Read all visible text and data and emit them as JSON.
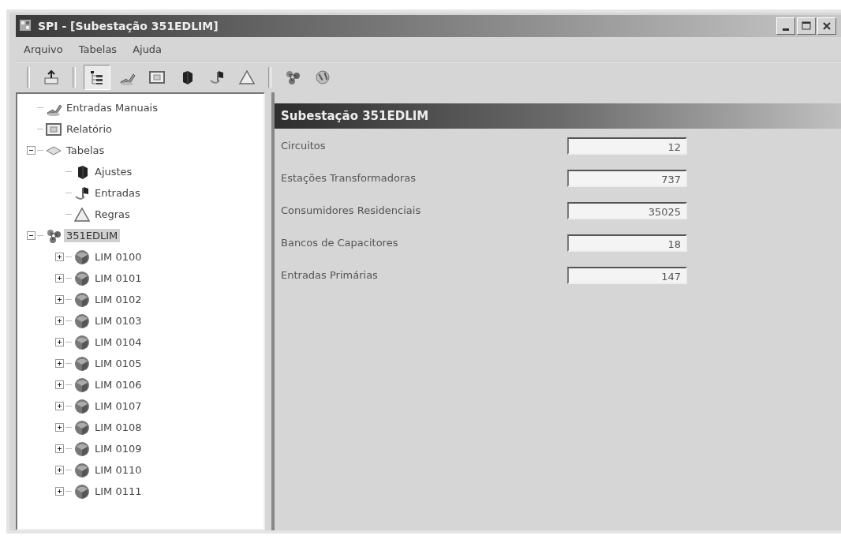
{
  "window": {
    "title": "SPI - [Subestação 351EDLIM]"
  },
  "menu": [
    "Arquivo",
    "Tabelas",
    "Ajuda"
  ],
  "toolbar": [
    {
      "kind": "separator"
    },
    {
      "kind": "upload",
      "selected": false
    },
    {
      "kind": "separator"
    },
    {
      "kind": "tree",
      "selected": true
    },
    {
      "kind": "manual",
      "selected": false
    },
    {
      "kind": "report",
      "selected": false
    },
    {
      "kind": "settings",
      "selected": false
    },
    {
      "kind": "entries",
      "selected": false
    },
    {
      "kind": "rules",
      "selected": false
    },
    {
      "kind": "separator"
    },
    {
      "kind": "substation",
      "selected": false
    },
    {
      "kind": "globe",
      "selected": false
    }
  ],
  "tree": [
    {
      "label": "Entradas Manuais",
      "kind": "manual",
      "selected": false
    },
    {
      "label": "Relatório",
      "kind": "report",
      "selected": false
    },
    {
      "label": "Tabelas",
      "kind": "tables",
      "selected": false,
      "expanded": true,
      "children": [
        {
          "label": "Ajustes",
          "kind": "settings",
          "selected": false
        },
        {
          "label": "Entradas",
          "kind": "entries",
          "selected": false
        },
        {
          "label": "Regras",
          "kind": "rules",
          "selected": false
        }
      ]
    },
    {
      "label": "351EDLIM",
      "kind": "substation",
      "selected": true,
      "expanded": true,
      "children": [
        {
          "label": "LIM 0100",
          "kind": "feeder",
          "selected": false,
          "expanded": false
        },
        {
          "label": "LIM 0101",
          "kind": "feeder",
          "selected": false,
          "expanded": false
        },
        {
          "label": "LIM 0102",
          "kind": "feeder",
          "selected": false,
          "expanded": false
        },
        {
          "label": "LIM 0103",
          "kind": "feeder",
          "selected": false,
          "expanded": false
        },
        {
          "label": "LIM 0104",
          "kind": "feeder",
          "selected": false,
          "expanded": false
        },
        {
          "label": "LIM 0105",
          "kind": "feeder",
          "selected": false,
          "expanded": false
        },
        {
          "label": "LIM 0106",
          "kind": "feeder",
          "selected": false,
          "expanded": false
        },
        {
          "label": "LIM 0107",
          "kind": "feeder",
          "selected": false,
          "expanded": false
        },
        {
          "label": "LIM 0108",
          "kind": "feeder",
          "selected": false,
          "expanded": false
        },
        {
          "label": "LIM 0109",
          "kind": "feeder",
          "selected": false,
          "expanded": false
        },
        {
          "label": "LIM 0110",
          "kind": "feeder",
          "selected": false,
          "expanded": false
        },
        {
          "label": "LIM 0111",
          "kind": "feeder",
          "selected": false,
          "expanded": false
        }
      ]
    }
  ],
  "panel": {
    "title": "Subestação 351EDLIM",
    "fields": [
      {
        "label": "Circuitos",
        "value": "12"
      },
      {
        "label": "Estações Transformadoras",
        "value": "737"
      },
      {
        "label": "Consumidores Residenciais",
        "value": "35025"
      },
      {
        "label": "Bancos de Capacitores",
        "value": "18"
      },
      {
        "label": "Entradas Primárias",
        "value": "147"
      }
    ]
  }
}
